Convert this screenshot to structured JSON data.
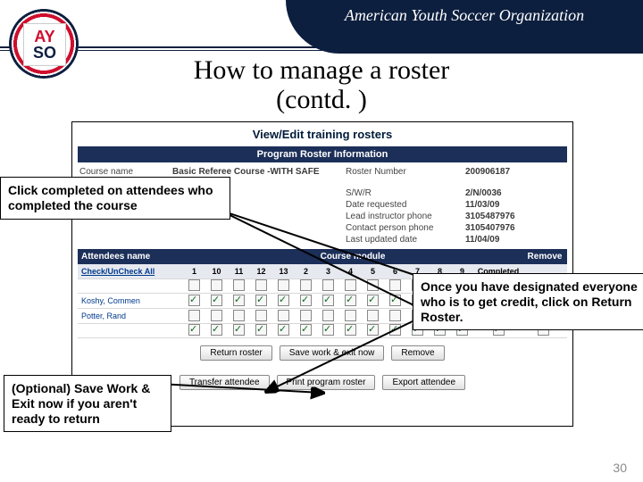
{
  "brand": {
    "short_a": "AY",
    "short_b": "SO",
    "ribbon_text": "American Youth Soccer Organization"
  },
  "slide": {
    "title_line1": "How to manage a roster",
    "title_line2": "(contd. )",
    "page_number": "30"
  },
  "callouts": {
    "left_top": "Click completed on attendees who completed the course",
    "right": "Once you have designated everyone who is to get credit, click on Return Roster.",
    "left_bottom": "(Optional) Save Work & Exit now if you aren't ready to return"
  },
  "screen": {
    "title": "View/Edit training rosters",
    "section_bar": "Program Roster Information",
    "module_bar": {
      "name": "Attendees name",
      "mid": "Course module",
      "rem": "Remove"
    },
    "info": {
      "course_name_lbl": "Course name",
      "course_name_val": "Basic Referee Course -WITH SAFE HAVEN",
      "roster_num_lbl": "Roster Number",
      "roster_num_val": "200906187",
      "swr_lbl": "S/W/R",
      "swr_val": "2/N/0036",
      "date_req_lbl": "Date requested",
      "date_req_val": "11/03/09",
      "lead_phone_lbl": "Lead instructor phone",
      "lead_phone_val": "3105487976",
      "contact_phone_lbl": "Contact person phone",
      "contact_phone_val": "3105407976",
      "updated_lbl": "Last updated date",
      "updated_val": "11/04/09"
    },
    "columns": [
      "1",
      "10",
      "11",
      "12",
      "13",
      "2",
      "3",
      "4",
      "5",
      "6",
      "7",
      "8",
      "9"
    ],
    "columns_extra": {
      "completed": "Completed"
    },
    "check_all": "Check/UnCheck All",
    "rows": [
      {
        "name": "",
        "checks": [
          0,
          0,
          0,
          0,
          0,
          0,
          0,
          0,
          0,
          0,
          0,
          0,
          0
        ],
        "completed": 0
      },
      {
        "name": "Koshy, Commen",
        "checks": [
          1,
          1,
          1,
          1,
          1,
          1,
          1,
          1,
          1,
          1,
          1,
          1,
          1
        ],
        "completed": 1
      },
      {
        "name": "Potter, Rand",
        "checks": [
          0,
          0,
          0,
          0,
          0,
          0,
          0,
          0,
          0,
          0,
          0,
          0,
          0
        ],
        "completed": 0
      },
      {
        "name": "",
        "checks": [
          1,
          1,
          1,
          1,
          1,
          1,
          1,
          1,
          1,
          1,
          1,
          1,
          1
        ],
        "completed": 1
      }
    ],
    "buttons": {
      "row1": [
        "Return roster",
        "Save work & exit now",
        "Remove"
      ],
      "row2": [
        "Transfer attendee",
        "Print program roster",
        "Export attendee"
      ]
    }
  }
}
